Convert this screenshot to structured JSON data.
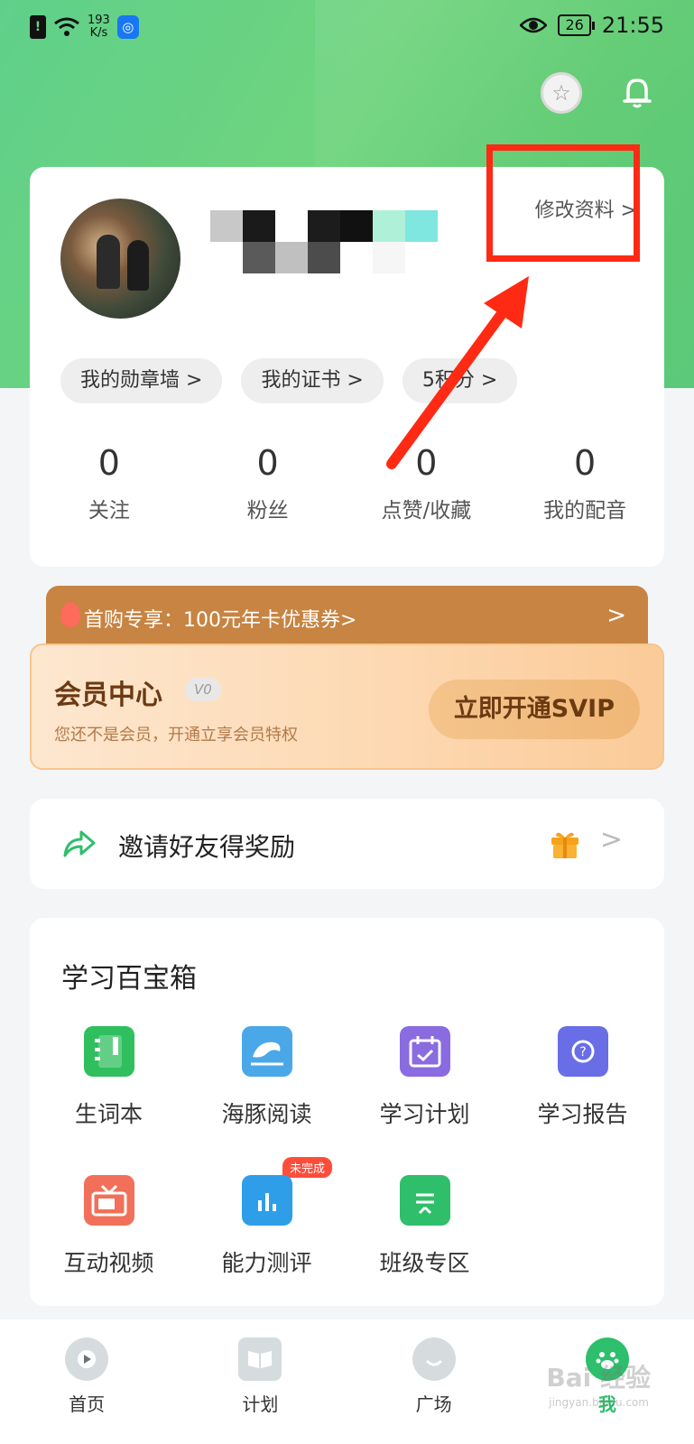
{
  "status_bar": {
    "net_speed_value": "193",
    "net_speed_unit": "K/s",
    "battery": "26",
    "time": "21:55"
  },
  "profile": {
    "edit_label": "修改资料 >",
    "chips": [
      "我的勋章墙 >",
      "我的证书 >",
      "5积分 >"
    ],
    "stats": [
      {
        "value": "0",
        "label": "关注"
      },
      {
        "value": "0",
        "label": "粉丝"
      },
      {
        "value": "0",
        "label": "点赞/收藏"
      },
      {
        "value": "0",
        "label": "我的配音"
      }
    ]
  },
  "promo": {
    "text": "首购专享：100元年卡优惠券>",
    "chevron": ">"
  },
  "vip": {
    "title": "会员中心",
    "level": "V0",
    "subtitle": "您还不是会员，开通立享会员特权",
    "button": "立即开通SVIP"
  },
  "invite": {
    "label": "邀请好友得奖励",
    "chevron": ">"
  },
  "toolbox": {
    "title": "学习百宝箱",
    "tools": [
      {
        "label": "生词本",
        "icon": "notebook-icon",
        "color": "#2fbf5e"
      },
      {
        "label": "海豚阅读",
        "icon": "dolphin-book-icon",
        "color": "#4aa8e8"
      },
      {
        "label": "学习计划",
        "icon": "calendar-icon",
        "color": "#8a6be0"
      },
      {
        "label": "学习报告",
        "icon": "report-icon",
        "color": "#6a6ee6"
      },
      {
        "label": "互动视频",
        "icon": "tv-icon",
        "color": "#f2705a"
      },
      {
        "label": "能力测评",
        "icon": "chart-board-icon",
        "color": "#2f9ee8",
        "badge": "未完成"
      },
      {
        "label": "班级专区",
        "icon": "class-board-icon",
        "color": "#2fbf6a"
      }
    ]
  },
  "nav": {
    "items": [
      {
        "label": "首页",
        "icon": "play-icon"
      },
      {
        "label": "计划",
        "icon": "book-icon"
      },
      {
        "label": "广场",
        "icon": "chat-bubble-icon"
      },
      {
        "label": "我",
        "icon": "paw-icon",
        "active": true
      }
    ]
  },
  "watermark": {
    "text": "Bai 经验",
    "sub": "jingyan.baidu.com"
  },
  "colors": {
    "brand_green": "#5fd08a",
    "annotation_red": "#ff2a14",
    "promo_bar": "#c78442",
    "vip_text": "#6b3a12"
  }
}
